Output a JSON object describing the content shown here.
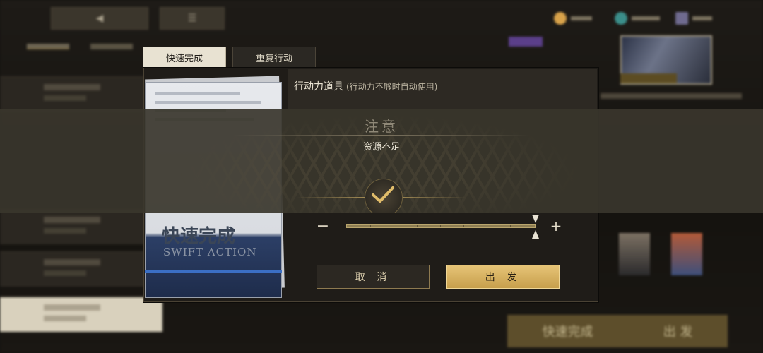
{
  "dialog": {
    "tabs": [
      {
        "label": "快速完成",
        "active": true
      },
      {
        "label": "重复行动",
        "active": false
      }
    ],
    "item_title": "行动力道具",
    "item_note": "(行动力不够时自动使用)",
    "card_title": "快速完成",
    "card_subtitle": "SWIFT ACTION",
    "slider": {
      "level": 1.0
    },
    "cancel_label": "取 消",
    "confirm_label": "出 发"
  },
  "notice": {
    "title": "注意",
    "message": "资源不足"
  },
  "background": {
    "bottom_left_label": "快速完成",
    "bottom_right_label": "出 发"
  },
  "colors": {
    "accent_gold": "#d6b060",
    "panel_dark": "#1f1c18",
    "banner": "#3a362c",
    "card_blue": "#3b6fc4"
  },
  "icons": [
    "back-arrow-icon",
    "menu-icon",
    "checkmark-icon",
    "minus-icon",
    "plus-icon"
  ]
}
